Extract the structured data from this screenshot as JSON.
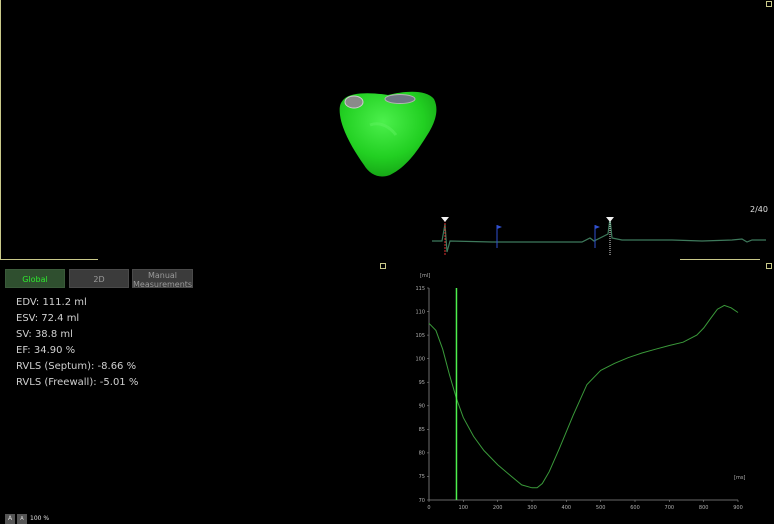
{
  "viewport": {
    "frame_number": "2/40",
    "zoom_level": "100 %",
    "zoom_buttons": [
      "A",
      "A"
    ]
  },
  "tabs": [
    {
      "label": "Global",
      "active": true
    },
    {
      "label": "2D",
      "active": false
    },
    {
      "label": "Manual Measurements",
      "active": false
    }
  ],
  "measurements": [
    {
      "label": "EDV:",
      "value": "111.2 ml"
    },
    {
      "label": "ESV:",
      "value": "72.4 ml"
    },
    {
      "label": "SV:",
      "value": "38.8 ml"
    },
    {
      "label": "EF:",
      "value": "34.90 %"
    },
    {
      "label": "RVLS (Septum):",
      "value": "-8.66 %"
    },
    {
      "label": "RVLS (Freewall):",
      "value": "-5.01 %"
    }
  ],
  "colors": {
    "model_green": "#22dd22",
    "ecg_line": "#3e7a5c",
    "volume_curve": "#3a9a3a",
    "cursor_line": "#4ef04e",
    "marker_blue": "#3050d0",
    "marker_red": "#e03030"
  },
  "chart_data": {
    "type": "line",
    "ylabel": "[ml]",
    "xlabel": "[ms]",
    "xlim": [
      0,
      900
    ],
    "ylim": [
      70,
      115
    ],
    "x_ticks": [
      0,
      100,
      200,
      300,
      400,
      500,
      600,
      700,
      800,
      900
    ],
    "y_ticks": [
      70,
      75,
      80,
      85,
      90,
      95,
      100,
      105,
      110,
      115
    ],
    "cursor_x": 80,
    "series": [
      {
        "x": [
          0,
          20,
          40,
          60,
          80,
          100,
          130,
          160,
          200,
          240,
          270,
          300,
          315,
          330,
          350,
          380,
          420,
          460,
          500,
          540,
          580,
          620,
          660,
          700,
          740,
          780,
          800,
          820,
          840,
          860,
          880,
          900
        ],
        "values": [
          107.5,
          106,
          102,
          96.5,
          91.5,
          87.5,
          83.5,
          80.5,
          77.5,
          75,
          73.2,
          72.6,
          72.6,
          73.5,
          76,
          81,
          88,
          94.5,
          97.5,
          99,
          100.2,
          101.2,
          102,
          102.8,
          103.5,
          105,
          106.5,
          108.5,
          110.5,
          111.3,
          110.8,
          109.8
        ]
      }
    ]
  }
}
